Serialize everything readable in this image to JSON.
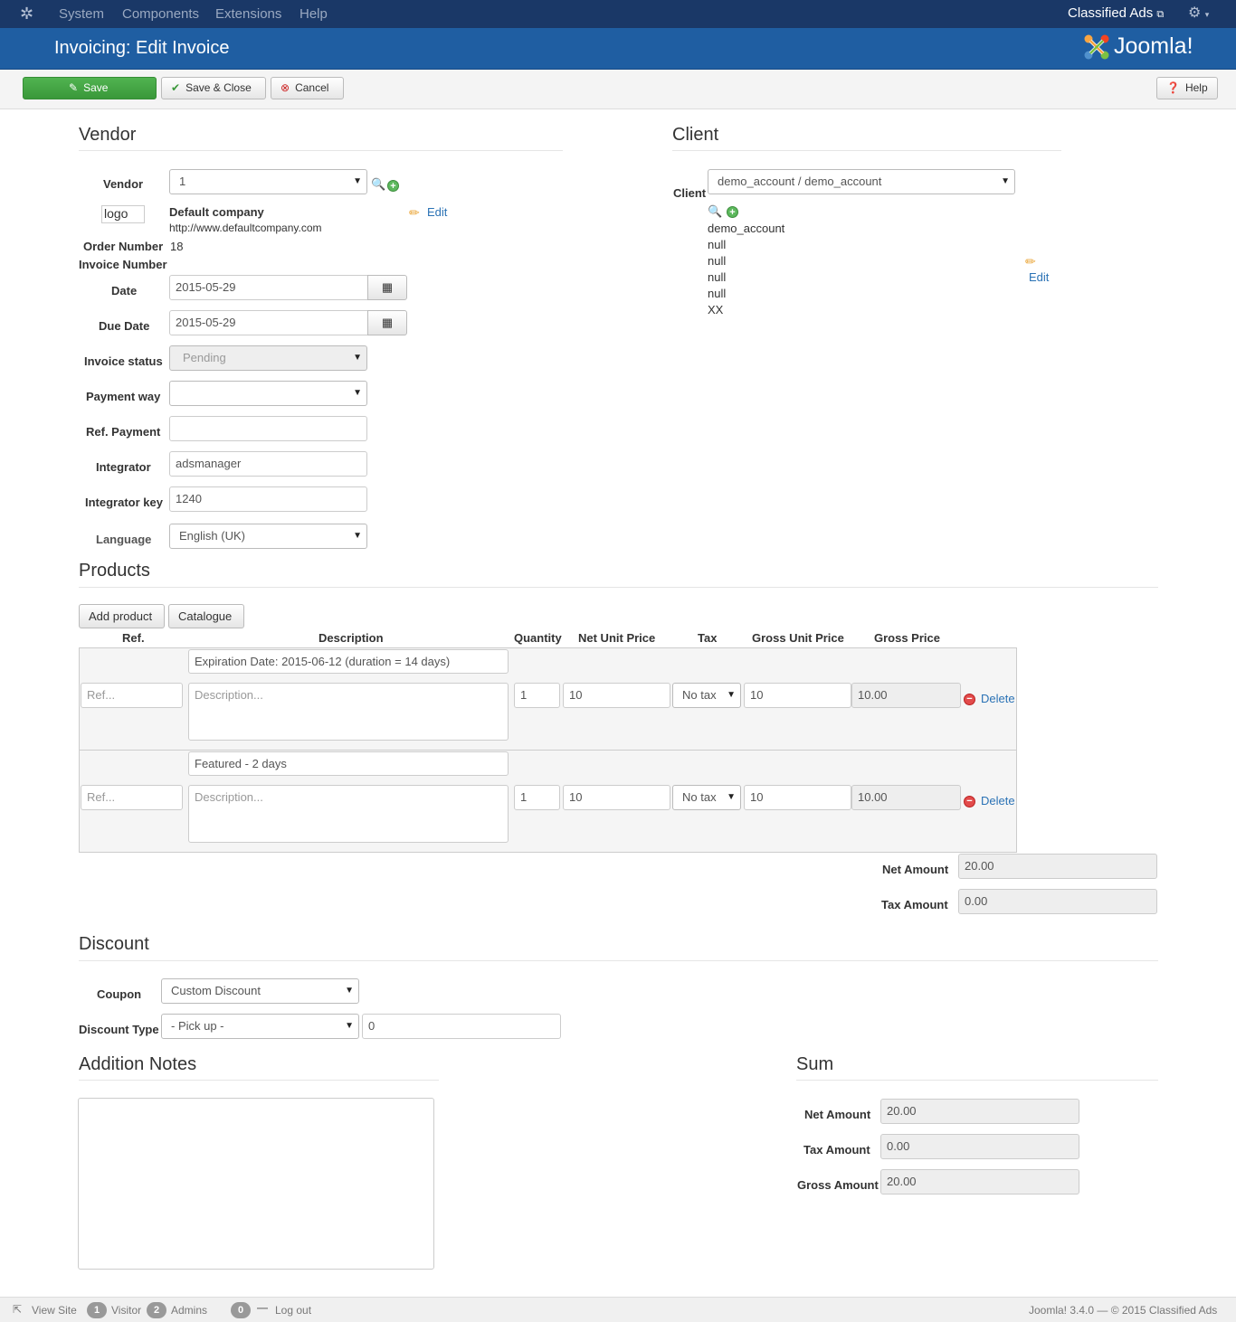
{
  "topnav": {
    "menu": [
      "System",
      "Components",
      "Extensions",
      "Help"
    ],
    "site_link": "Classified Ads"
  },
  "header": {
    "title": "Invoicing: Edit Invoice",
    "brand": "Joomla!"
  },
  "toolbar": {
    "save": "Save",
    "save_close": "Save & Close",
    "cancel": "Cancel",
    "help": "Help"
  },
  "vendor": {
    "heading": "Vendor",
    "vendor_label": "Vendor",
    "vendor_value": "1",
    "logo_alt": "logo",
    "company": "Default company",
    "website": "http://www.defaultcompany.com",
    "edit": "Edit",
    "order_number_label": "Order Number",
    "order_number": "18",
    "invoice_number_label": "Invoice Number",
    "date_label": "Date",
    "date": "2015-05-29",
    "due_date_label": "Due Date",
    "due_date": "2015-05-29",
    "status_label": "Invoice status",
    "status": "Pending",
    "payment_way_label": "Payment way",
    "payment_way": "",
    "ref_payment_label": "Ref. Payment",
    "ref_payment": "",
    "integrator_label": "Integrator",
    "integrator": "adsmanager",
    "integrator_key_label": "Integrator key",
    "integrator_key": "1240",
    "language_label": "Language",
    "language": "English (UK)"
  },
  "client": {
    "heading": "Client",
    "label": "Client",
    "selected": "demo_account / demo_account",
    "lines": [
      "demo_account",
      "null",
      "null",
      "null",
      "null",
      "XX"
    ],
    "edit": "Edit"
  },
  "products": {
    "heading": "Products",
    "add_product": "Add product",
    "catalogue": "Catalogue",
    "columns": [
      "Ref.",
      "Description",
      "Quantity",
      "Net Unit Price",
      "Tax",
      "Gross Unit Price",
      "Gross Price"
    ],
    "rows": [
      {
        "name": "Expiration Date: 2015-06-12 (duration = 14 days)",
        "ref_placeholder": "Ref...",
        "desc_placeholder": "Description...",
        "quantity": "1",
        "net_unit": "10",
        "tax": "No tax",
        "gross_unit": "10",
        "gross_price": "10.00",
        "delete": "Delete"
      },
      {
        "name": "Featured - 2 days",
        "ref_placeholder": "Ref...",
        "desc_placeholder": "Description...",
        "quantity": "1",
        "net_unit": "10",
        "tax": "No tax",
        "gross_unit": "10",
        "gross_price": "10.00",
        "delete": "Delete"
      }
    ],
    "net_amount_label": "Net Amount",
    "net_amount": "20.00",
    "tax_amount_label": "Tax Amount",
    "tax_amount": "0.00"
  },
  "discount": {
    "heading": "Discount",
    "coupon_label": "Coupon",
    "coupon": "Custom Discount",
    "type_label": "Discount Type",
    "type": "- Pick up -",
    "value": "0"
  },
  "notes": {
    "heading": "Addition Notes"
  },
  "sum": {
    "heading": "Sum",
    "net_label": "Net Amount",
    "net": "20.00",
    "tax_label": "Tax Amount",
    "tax": "0.00",
    "gross_label": "Gross Amount",
    "gross": "20.00"
  },
  "footer": {
    "view_site": "View Site",
    "visitors_count": "1",
    "visitors_label": "Visitor",
    "admins_count": "2",
    "admins_label": "Admins",
    "messages_count": "0",
    "logout": "Log out",
    "version": "Joomla! 3.4.0 — © 2015 Classified Ads"
  }
}
